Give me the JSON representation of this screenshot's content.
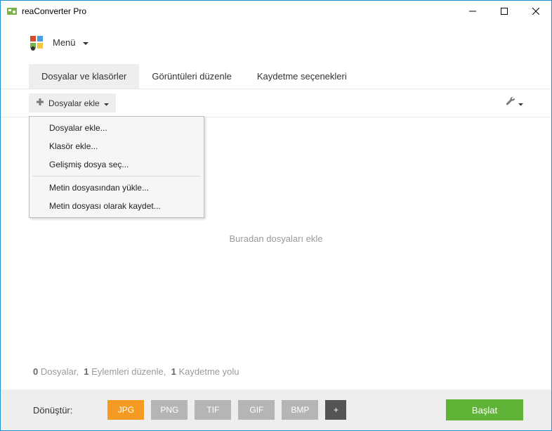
{
  "title": "reaConverter Pro",
  "menu": {
    "label": "Menü"
  },
  "tabs": {
    "files": "Dosyalar ve klasörler",
    "edit": "Görüntüleri düzenle",
    "save": "Kaydetme seçenekleri"
  },
  "toolbar": {
    "add_files": "Dosyalar ekle"
  },
  "dropdown": {
    "add_files": "Dosyalar ekle...",
    "add_folder": "Klasör ekle...",
    "advanced": "Gelişmiş dosya seç...",
    "load_txt": "Metin dosyasından yükle...",
    "save_txt": "Metin dosyası olarak kaydet..."
  },
  "placeholder": "Buradan dosyaları ekle",
  "status": {
    "files_n": "0",
    "files_l": "Dosyalar,",
    "actions_n": "1",
    "actions_l": "Eylemleri düzenle,",
    "path_n": "1",
    "path_l": "Kaydetme yolu"
  },
  "footer": {
    "convert": "Dönüştür:",
    "jpg": "JPG",
    "png": "PNG",
    "tif": "TIF",
    "gif": "GIF",
    "bmp": "BMP",
    "plus": "+",
    "start": "Başlat"
  }
}
